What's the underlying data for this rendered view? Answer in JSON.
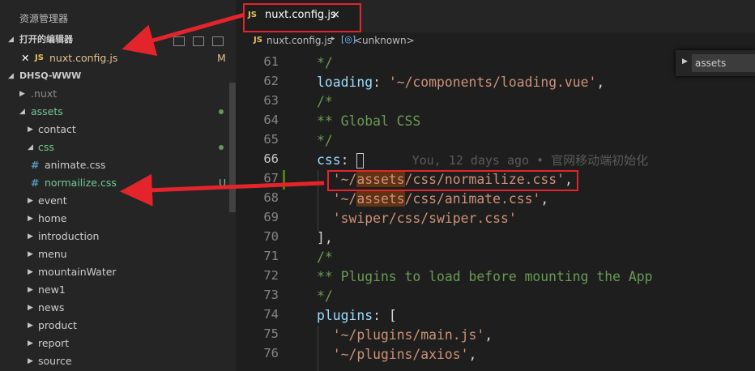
{
  "sidebar": {
    "title": "资源管理器",
    "open_editors": {
      "label": "打开的编辑器",
      "file": {
        "icon": "JS",
        "name": "nuxt.config.js",
        "status": "M"
      }
    },
    "project": "DHSQ-WWW",
    "tree": [
      {
        "label": ".nuxt",
        "kind": "folder",
        "expanded": false
      },
      {
        "label": "assets",
        "kind": "folder",
        "expanded": true
      },
      {
        "label": "contact",
        "kind": "folder",
        "expanded": false
      },
      {
        "label": "css",
        "kind": "folder",
        "expanded": true
      },
      {
        "label": "animate.css",
        "kind": "file",
        "icon": "#"
      },
      {
        "label": "normailize.css",
        "kind": "file",
        "icon": "#",
        "status": "U"
      },
      {
        "label": "event",
        "kind": "folder",
        "expanded": false
      },
      {
        "label": "home",
        "kind": "folder",
        "expanded": false
      },
      {
        "label": "introduction",
        "kind": "folder",
        "expanded": false
      },
      {
        "label": "menu",
        "kind": "folder",
        "expanded": false
      },
      {
        "label": "mountainWater",
        "kind": "folder",
        "expanded": false
      },
      {
        "label": "new1",
        "kind": "folder",
        "expanded": false
      },
      {
        "label": "news",
        "kind": "folder",
        "expanded": false
      },
      {
        "label": "product",
        "kind": "folder",
        "expanded": false
      },
      {
        "label": "report",
        "kind": "folder",
        "expanded": false
      },
      {
        "label": "source",
        "kind": "folder",
        "expanded": false
      }
    ]
  },
  "tab": {
    "icon": "JS",
    "name": "nuxt.config.js",
    "close": "×"
  },
  "breadcrumb": {
    "icon": "JS",
    "file": "nuxt.config.js",
    "symbol_icon": "[◎]",
    "symbol": "<unknown>"
  },
  "find": {
    "value": "assets"
  },
  "editor": {
    "line_numbers": [
      "61",
      "62",
      "63",
      "64",
      "65",
      "66",
      "67",
      "68",
      "69",
      "70",
      "71",
      "72",
      "73",
      "74",
      "75",
      "76"
    ],
    "active_line": "66",
    "lines": {
      "l61": "*/",
      "l62_key": "loading",
      "l62_sep": ": ",
      "l62_val": "'~/components/loading.vue'",
      "l62_end": ",",
      "l63": "/*",
      "l64": "** Global CSS",
      "l65": "*/",
      "l66_key": "css",
      "l66_sep": ": ",
      "l66_blame": "You, 12 days ago • 官网移动端初始化",
      "l67_a": "'~/",
      "l67_hl": "assets",
      "l67_b": "/css/normailize.css'",
      "l67_end": ",",
      "l68_a": "'~/",
      "l68_hl": "assets",
      "l68_b": "/css/animate.css'",
      "l68_end": ",",
      "l69": "'swiper/css/swiper.css'",
      "l70": "],",
      "l71": "/*",
      "l72": "** Plugins to load before mounting the App",
      "l73": "*/",
      "l74_key": "plugins",
      "l74_sep": ": [",
      "l75": "'~/plugins/main.js'",
      "l75_end": ",",
      "l76": "'~/plugins/axios'",
      "l76_end": ","
    }
  },
  "colors": {
    "annotation": "#e3242b",
    "comment": "#6a9955",
    "string": "#ce9178",
    "key": "#9cdcfe"
  }
}
